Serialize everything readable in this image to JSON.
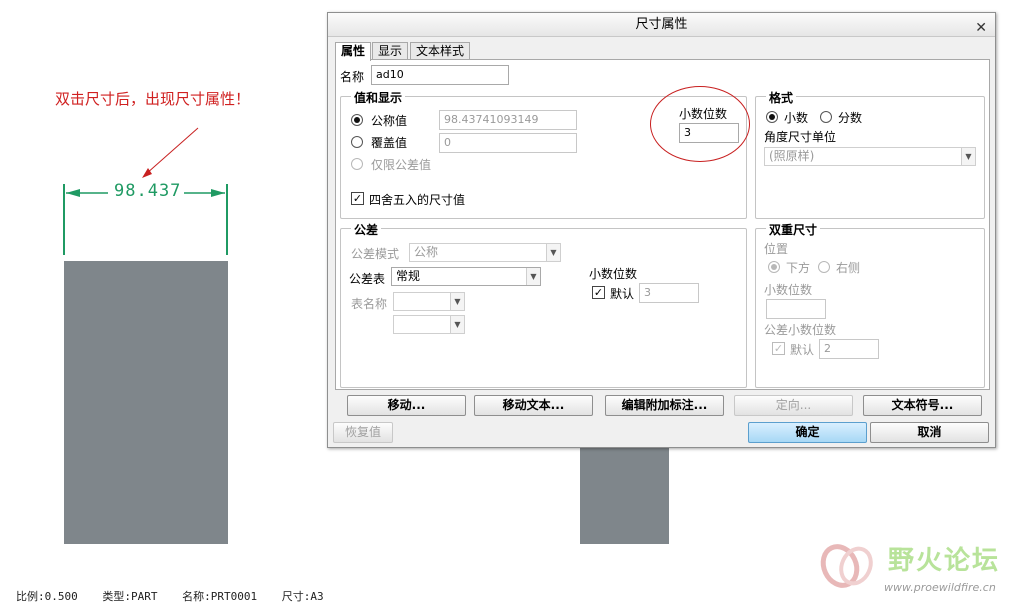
{
  "annotation": {
    "note": "双击尺寸后，出现尺寸属性！"
  },
  "drawing": {
    "dimension_value": "98.437"
  },
  "status_bar": {
    "scale": "比例:0.500",
    "type": "类型:PART",
    "name": "名称:PRT0001",
    "size": "尺寸:A3"
  },
  "watermark": {
    "title": "野火论坛",
    "url": "www.proewildfire.cn"
  },
  "dialog": {
    "title": "尺寸属性",
    "tabs": [
      "属性",
      "显示",
      "文本样式"
    ],
    "name_label": "名称",
    "name_value": "ad10",
    "value_display": {
      "title": "值和显示",
      "nominal_label": "公称值",
      "nominal_value": "98.43741093149",
      "override_label": "覆盖值",
      "override_value": "0",
      "tol_only_label": "仅限公差值",
      "round_label": "四舍五入的尺寸值",
      "round_checked": true,
      "decimals_label": "小数位数",
      "decimals_value": "3"
    },
    "format": {
      "title": "格式",
      "decimal_label": "小数",
      "fraction_label": "分数",
      "angle_unit_label": "角度尺寸单位",
      "angle_unit_value": "(照原样)"
    },
    "tolerance": {
      "title": "公差",
      "mode_label": "公差模式",
      "mode_value": "公称",
      "table_label": "公差表",
      "table_value": "常规",
      "table_name_label": "表名称",
      "decimals_label": "小数位数",
      "default_label": "默认",
      "default_checked": true,
      "decimals_value": "3"
    },
    "dual": {
      "title": "双重尺寸",
      "position_label": "位置",
      "below_label": "下方",
      "right_label": "右侧",
      "decimals_label": "小数位数",
      "decimals_value": "",
      "tol_decimals_label": "公差小数位数",
      "default_label": "默认",
      "default_value": "2"
    },
    "buttons": {
      "move": "移动...",
      "move_text": "移动文本...",
      "edit_attach": "编辑附加标注...",
      "orient": "定向...",
      "text_symbol": "文本符号...",
      "restore": "恢复值",
      "ok": "确定",
      "cancel": "取消"
    }
  },
  "colors": {
    "annotation_red": "#d02020",
    "dimension_green": "#1f9a63",
    "part_gray": "#7f868b"
  }
}
